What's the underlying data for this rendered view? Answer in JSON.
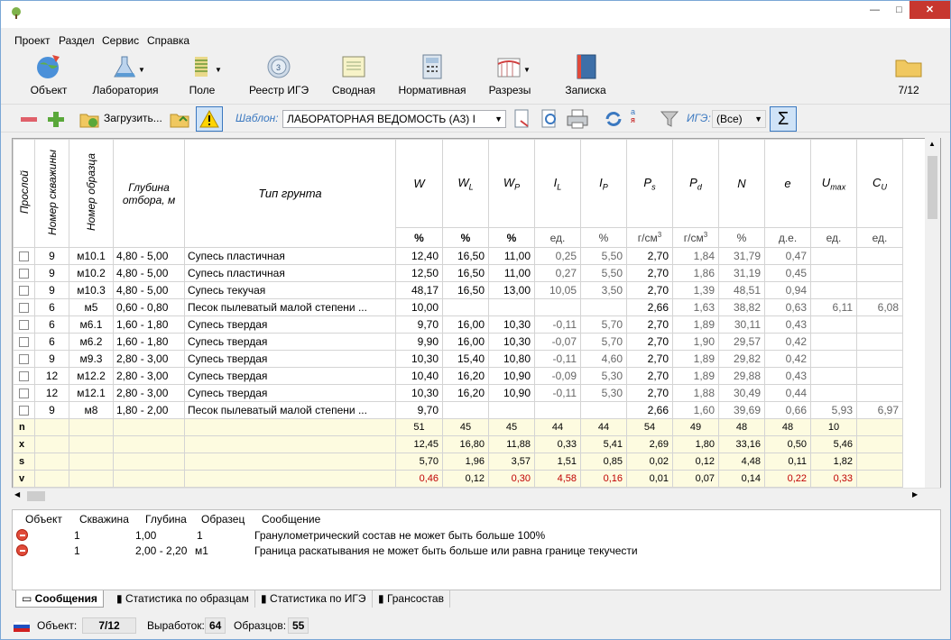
{
  "window": {
    "min": "—",
    "max": "□",
    "close": "✕"
  },
  "menu": [
    "Проект",
    "Раздел",
    "Сервис",
    "Справка"
  ],
  "ribbon": [
    {
      "label": "Объект",
      "icon": "globe-icon"
    },
    {
      "label": "Лаборатория",
      "icon": "flask-icon"
    },
    {
      "label": "Поле",
      "icon": "drill-icon"
    },
    {
      "label": "Реестр ИГЭ",
      "icon": "layers-icon"
    },
    {
      "label": "Сводная",
      "icon": "notebook-icon"
    },
    {
      "label": "Нормативная",
      "icon": "calculator-icon"
    },
    {
      "label": "Разрезы",
      "icon": "section-icon"
    },
    {
      "label": "Записка",
      "icon": "book-icon"
    },
    {
      "label": "7/12",
      "icon": "folder-icon"
    }
  ],
  "toolbar": {
    "load_label": "Загрузить...",
    "template_label": "Шаблон:",
    "template_value": "ЛАБОРАТОРНАЯ ВЕДОМОСТЬ (А3) I",
    "ige_label": "ИГЭ:",
    "ige_value": "(Все)",
    "sum_symbol": "Σ",
    "sort_a": "а",
    "sort_ya": "я"
  },
  "grid": {
    "headers": {
      "skip": "Прослой",
      "well": "Номер скважины",
      "sample": "Номер образца",
      "depth": "Глубина отбора, м",
      "soil": "Тип грунта"
    },
    "params": [
      {
        "main": "W",
        "sub": "",
        "sup": "",
        "unit": "%",
        "bold": true
      },
      {
        "main": "W",
        "sub": "L",
        "sup": "",
        "unit": "%",
        "bold": true
      },
      {
        "main": "W",
        "sub": "P",
        "sup": "",
        "unit": "%",
        "bold": true
      },
      {
        "main": "I",
        "sub": "L",
        "sup": "",
        "unit": "ед.",
        "bold": false
      },
      {
        "main": "I",
        "sub": "P",
        "sup": "",
        "unit": "%",
        "bold": false
      },
      {
        "main": "P",
        "sub": "s",
        "sup": "3",
        "unit": "г/см",
        "bold": false
      },
      {
        "main": "P",
        "sub": "d",
        "sup": "3",
        "unit": "г/см",
        "bold": false
      },
      {
        "main": "N",
        "sub": "",
        "sup": "",
        "unit": "%",
        "bold": false
      },
      {
        "main": "e",
        "sub": "",
        "sup": "",
        "unit": "д.е.",
        "bold": false
      },
      {
        "main": "U",
        "sub": "max",
        "sup": "",
        "unit": "ед.",
        "bold": false
      },
      {
        "main": "C",
        "sub": "U",
        "sup": "",
        "unit": "ед.",
        "bold": false
      }
    ],
    "rows": [
      {
        "well": "9",
        "sample": "м10.1",
        "depth": "4,80 - 5,00",
        "soil": "Супесь пластичная",
        "v": [
          "12,40",
          "16,50",
          "11,00",
          "0,25",
          "5,50",
          "2,70",
          "1,84",
          "31,79",
          "0,47",
          "",
          ""
        ]
      },
      {
        "well": "9",
        "sample": "м10.2",
        "depth": "4,80 - 5,00",
        "soil": "Супесь пластичная",
        "v": [
          "12,50",
          "16,50",
          "11,00",
          "0,27",
          "5,50",
          "2,70",
          "1,86",
          "31,19",
          "0,45",
          "",
          ""
        ]
      },
      {
        "well": "9",
        "sample": "м10.3",
        "depth": "4,80 - 5,00",
        "soil": "Супесь текучая",
        "v": [
          "48,17",
          "16,50",
          "13,00",
          "10,05",
          "3,50",
          "2,70",
          "1,39",
          "48,51",
          "0,94",
          "",
          ""
        ]
      },
      {
        "well": "6",
        "sample": "м5",
        "depth": "0,60 - 0,80",
        "soil": "Песок пылеватый малой степени ...",
        "v": [
          "10,00",
          "",
          "",
          "",
          "",
          "2,66",
          "1,63",
          "38,82",
          "0,63",
          "6,11",
          "6,08"
        ]
      },
      {
        "well": "6",
        "sample": "м6.1",
        "depth": "1,60 - 1,80",
        "soil": "Супесь твердая",
        "v": [
          "9,70",
          "16,00",
          "10,30",
          "-0,11",
          "5,70",
          "2,70",
          "1,89",
          "30,11",
          "0,43",
          "",
          ""
        ]
      },
      {
        "well": "6",
        "sample": "м6.2",
        "depth": "1,60 - 1,80",
        "soil": "Супесь твердая",
        "v": [
          "9,90",
          "16,00",
          "10,30",
          "-0,07",
          "5,70",
          "2,70",
          "1,90",
          "29,57",
          "0,42",
          "",
          ""
        ]
      },
      {
        "well": "9",
        "sample": "м9.3",
        "depth": "2,80 - 3,00",
        "soil": "Супесь твердая",
        "v": [
          "10,30",
          "15,40",
          "10,80",
          "-0,11",
          "4,60",
          "2,70",
          "1,89",
          "29,82",
          "0,42",
          "",
          ""
        ]
      },
      {
        "well": "12",
        "sample": "м12.2",
        "depth": "2,80 - 3,00",
        "soil": "Супесь твердая",
        "v": [
          "10,40",
          "16,20",
          "10,90",
          "-0,09",
          "5,30",
          "2,70",
          "1,89",
          "29,88",
          "0,43",
          "",
          ""
        ]
      },
      {
        "well": "12",
        "sample": "м12.1",
        "depth": "2,80 - 3,00",
        "soil": "Супесь твердая",
        "v": [
          "10,30",
          "16,20",
          "10,90",
          "-0,11",
          "5,30",
          "2,70",
          "1,88",
          "30,49",
          "0,44",
          "",
          ""
        ]
      },
      {
        "well": "9",
        "sample": "м8",
        "depth": "1,80 - 2,00",
        "soil": "Песок пылеватый малой степени ...",
        "v": [
          "9,70",
          "",
          "",
          "",
          "",
          "2,66",
          "1,60",
          "39,69",
          "0,66",
          "5,93",
          "6,97"
        ]
      }
    ],
    "stats": [
      {
        "key": "n",
        "v": [
          "51",
          "45",
          "45",
          "44",
          "44",
          "54",
          "49",
          "48",
          "48",
          "10",
          ""
        ],
        "red": []
      },
      {
        "key": "x",
        "v": [
          "12,45",
          "16,80",
          "11,88",
          "0,33",
          "5,41",
          "2,69",
          "1,80",
          "33,16",
          "0,50",
          "5,46",
          ""
        ],
        "red": []
      },
      {
        "key": "s",
        "v": [
          "5,70",
          "1,96",
          "3,57",
          "1,51",
          "0,85",
          "0,02",
          "0,12",
          "4,48",
          "0,11",
          "1,82",
          ""
        ],
        "red": []
      },
      {
        "key": "v",
        "v": [
          "0,46",
          "0,12",
          "0,30",
          "4,58",
          "0,16",
          "0,01",
          "0,07",
          "0,14",
          "0,22",
          "0,33",
          ""
        ],
        "red": [
          0,
          2,
          3,
          4,
          8,
          9
        ]
      }
    ]
  },
  "messages": {
    "headers": [
      "Объект",
      "Скважина",
      "Глубина",
      "Образец",
      "Сообщение"
    ],
    "rows": [
      {
        "object": "1",
        "well": "1,00",
        "depth": "1",
        "sample": "",
        "text": "Гранулометрический состав не может быть больше 100%"
      },
      {
        "object": "1",
        "well": "2,00 - 2,20",
        "depth": "м1",
        "sample": "",
        "text": "Граница раскатывания не может быть больше или равна границе текучести"
      }
    ]
  },
  "tabs": [
    "Сообщения",
    "Статистика по образцам",
    "Статистика по ИГЭ",
    "Грансостав"
  ],
  "status": {
    "object_label": "Объект:",
    "object_value": "7/12",
    "workings_label": "Выработок:",
    "workings_value": "64",
    "samples_label": "Образцов:",
    "samples_value": "55"
  },
  "colors": {
    "stats_bg": "#fdfbe0",
    "warn_red": "#c00000",
    "accent": "#3a78c0"
  }
}
